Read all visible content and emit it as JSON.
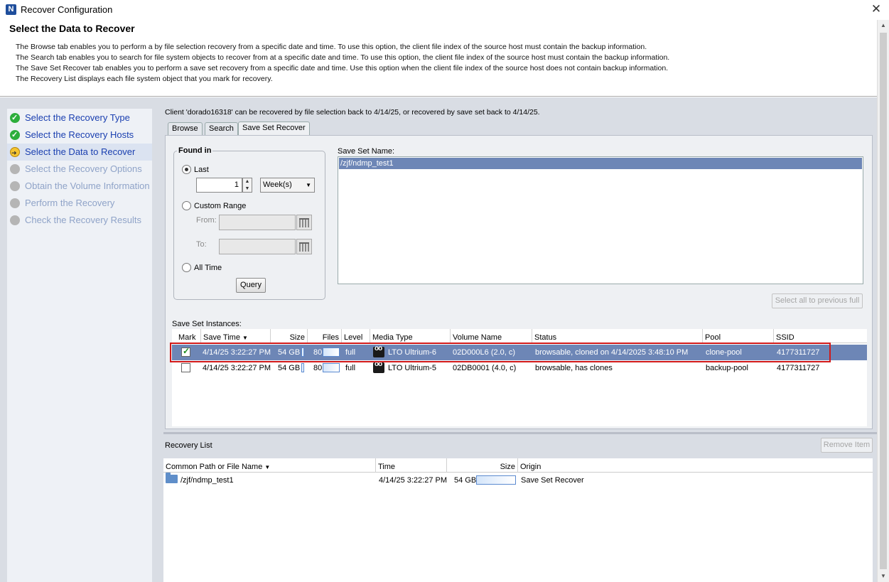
{
  "window": {
    "title": "Recover Configuration",
    "close_glyph": "✕"
  },
  "header": {
    "title": "Select the Data to Recover",
    "lines": [
      "The Browse tab enables you to perform a by file selection recovery from a specific date and time. To use this option, the client file index of the source host must contain the backup information.",
      "The Search tab enables you to search for file system objects to recover from at a specific date and time. To use this option, the client file index of the source host must contain the backup information.",
      "The Save Set Recover tab enables you to perform a save set recovery from a specific date and time.  Use this option when the client file index of the source host does not contain backup information.",
      "The Recovery List displays each file system object that you mark for recovery."
    ]
  },
  "wizard": {
    "steps": [
      {
        "label": "Select the Recovery Type",
        "state": "done"
      },
      {
        "label": "Select the Recovery Hosts",
        "state": "done"
      },
      {
        "label": "Select the Data to Recover",
        "state": "current"
      },
      {
        "label": "Select the Recovery Options",
        "state": "pending"
      },
      {
        "label": "Obtain the Volume Information",
        "state": "pending"
      },
      {
        "label": "Perform the Recovery",
        "state": "pending"
      },
      {
        "label": "Check the Recovery Results",
        "state": "pending"
      }
    ]
  },
  "client_message": "Client 'dorado16318' can be recovered by file selection back to 4/14/25, or recovered by save set back to 4/14/25.",
  "tabs": [
    {
      "label": "Browse",
      "active": false
    },
    {
      "label": "Search",
      "active": false
    },
    {
      "label": "Save Set Recover",
      "active": true
    }
  ],
  "found_in": {
    "title": "Found in",
    "last_label": "Last",
    "last_value": "1",
    "unit": "Week(s)",
    "custom_label": "Custom Range",
    "from_label": "From:",
    "to_label": "To:",
    "all_time_label": "All Time",
    "query_button": "Query",
    "selected": "last"
  },
  "save_set_name": {
    "label": "Save Set Name:",
    "items": [
      "/zjf/ndmp_test1"
    ],
    "select_all_button": "Select all to previous full"
  },
  "instances": {
    "label": "Save Set Instances:",
    "columns": [
      "Mark",
      "Save Time",
      "Size",
      "Files",
      "Level",
      "Media Type",
      "Volume Name",
      "Status",
      "Pool",
      "SSID"
    ],
    "sort_glyph": "▼",
    "rows": [
      {
        "mark": true,
        "save_time": "4/14/25 3:22:27 PM",
        "size": "54 GB",
        "files": "80",
        "level": "full",
        "media_type": "LTO Ultrium-6",
        "volume_name": "02D000L6 (2.0, c)",
        "status": "browsable,   cloned on 4/14/2025 3:48:10 PM",
        "pool": "clone-pool",
        "ssid": "4177311727",
        "selected": true
      },
      {
        "mark": false,
        "save_time": "4/14/25 3:22:27 PM",
        "size": "54 GB",
        "files": "80",
        "level": "full",
        "media_type": "LTO Ultrium-5",
        "volume_name": "02DB0001 (4.0, c)",
        "status": "browsable,  has clones",
        "pool": "backup-pool",
        "ssid": "4177311727",
        "selected": false
      }
    ]
  },
  "recovery_list": {
    "label": "Recovery List",
    "remove_button": "Remove Item",
    "columns": [
      "Common Path or File Name",
      "Time",
      "Size",
      "Origin"
    ],
    "sort_glyph": "▼",
    "rows": [
      {
        "path": "/zjf/ndmp_test1",
        "time": "4/14/25 3:22:27 PM",
        "size": "54 GB",
        "origin": "Save Set Recover"
      }
    ]
  },
  "colors": {
    "selection": "#6d86b6",
    "highlight_box": "#d11a1a",
    "link_blue": "#1a3fb0",
    "done_green": "#2dae3c"
  }
}
